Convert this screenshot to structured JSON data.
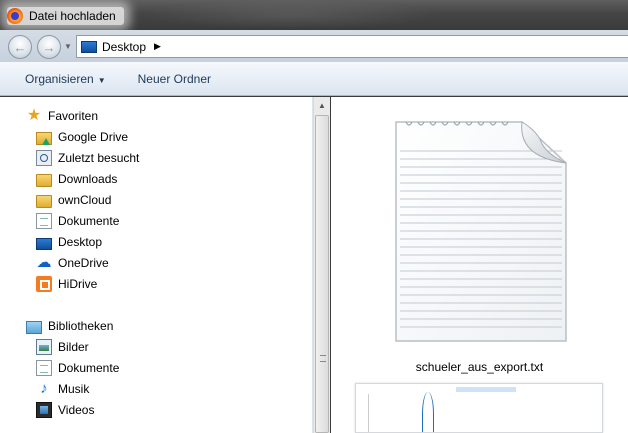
{
  "window": {
    "title": "Datei hochladen",
    "app_icon": "firefox-icon"
  },
  "addressbar": {
    "location": "Desktop",
    "location_icon": "desktop-icon",
    "separator_icon": "chevron-right-icon"
  },
  "toolbar": {
    "organize_label": "Organisieren",
    "new_folder_label": "Neuer Ordner"
  },
  "navpane": {
    "favorites_label": "Favoriten",
    "favorites": [
      {
        "label": "Google Drive",
        "icon": "google-drive-folder-icon"
      },
      {
        "label": "Zuletzt besucht",
        "icon": "recent-places-icon"
      },
      {
        "label": "Downloads",
        "icon": "folder-icon"
      },
      {
        "label": "ownCloud",
        "icon": "folder-icon"
      },
      {
        "label": "Dokumente",
        "icon": "document-icon"
      },
      {
        "label": "Desktop",
        "icon": "desktop-icon"
      },
      {
        "label": "OneDrive",
        "icon": "onedrive-icon"
      },
      {
        "label": "HiDrive",
        "icon": "hidrive-icon"
      }
    ],
    "libraries_label": "Bibliotheken",
    "libraries": [
      {
        "label": "Bilder",
        "icon": "pictures-icon"
      },
      {
        "label": "Dokumente",
        "icon": "document-icon"
      },
      {
        "label": "Musik",
        "icon": "music-icon"
      },
      {
        "label": "Videos",
        "icon": "video-icon"
      }
    ]
  },
  "content": {
    "files": [
      {
        "name": "schueler_aus_export.txt",
        "icon": "text-file-icon"
      },
      {
        "name": "",
        "icon": "chart-thumbnail-icon"
      }
    ]
  },
  "colors": {
    "toolbar_text": "#1e3957",
    "selection_accent": "#3399ff"
  }
}
